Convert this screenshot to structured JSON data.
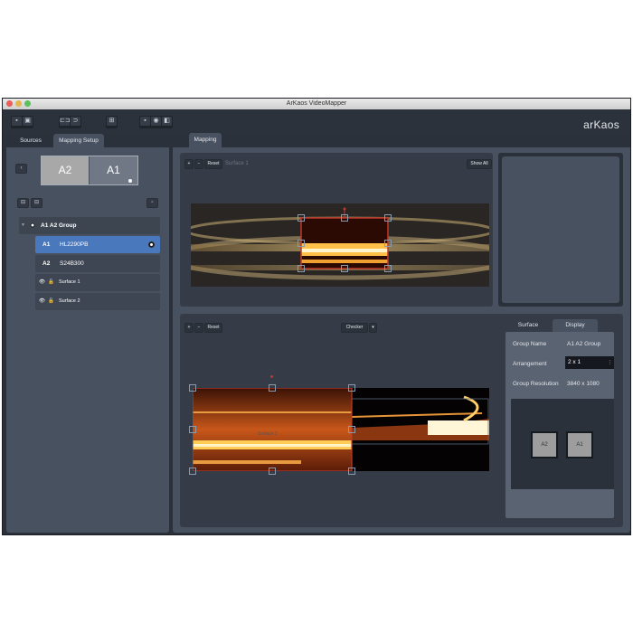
{
  "window": {
    "title": "ArKaos VideoMapper",
    "brand": "arKaos",
    "traffic_lights": {
      "close": "#ec5f57",
      "minimize": "#e5b54a",
      "zoom": "#5bc15a"
    }
  },
  "toolbar": {
    "groups": [
      {
        "icons": [
          "window-single-icon",
          "window-grid-icon"
        ]
      },
      {
        "icons": [
          "link-icon",
          "unlink-icon"
        ]
      },
      {
        "icons": [
          "fit-icon"
        ]
      },
      {
        "icons": [
          "view-output-icon",
          "view-camera-icon",
          "view-preview-icon"
        ]
      }
    ]
  },
  "left_panel": {
    "tabs": [
      {
        "label": "Sources",
        "active": false
      },
      {
        "label": "Mapping Setup",
        "active": true
      }
    ],
    "back_button": "‹",
    "displays": [
      {
        "label": "A2",
        "selected": true
      },
      {
        "label": "A1",
        "selected": false
      }
    ],
    "add_buttons": [
      "add-display-icon",
      "add-group-icon"
    ],
    "options_button": "options-icon",
    "tree": [
      {
        "type": "group",
        "label": "A1 A2 Group"
      },
      {
        "type": "display",
        "id": "A1",
        "name": "HL2290PB",
        "selected": true
      },
      {
        "type": "display",
        "id": "A2",
        "name": "S24B300",
        "selected": false
      },
      {
        "type": "surface",
        "label": "Surface 1"
      },
      {
        "type": "surface",
        "label": "Surface 2"
      }
    ]
  },
  "main": {
    "tab_label": "Mapping",
    "input_pane": {
      "zoom_in": "+",
      "zoom_out": "−",
      "reset_label": "Reset",
      "surface_label": "Surface 1",
      "show_all_label": "Show All"
    },
    "output_pane": {
      "zoom_in": "+",
      "zoom_out": "−",
      "reset_label": "Reset",
      "background_label": "Checker",
      "dropdown_arrow": "▾",
      "surface_overlay_label": "Surface 1"
    },
    "properties": {
      "tabs": [
        {
          "label": "Surface",
          "active": false
        },
        {
          "label": "Display",
          "active": true
        }
      ],
      "group_name_label": "Group Name",
      "group_name_value": "A1 A2 Group",
      "arrangement_label": "Arrangement",
      "arrangement_value": "2 x 1",
      "resolution_label": "Group Resolution",
      "resolution_value": "3840 x 1080",
      "preview_displays": [
        "A2",
        "A1"
      ]
    }
  },
  "colors": {
    "selection_blue": "#4a78bd",
    "handle_red": "#c0392b",
    "panel_bg": "#485160",
    "window_bg": "#2b313b"
  }
}
